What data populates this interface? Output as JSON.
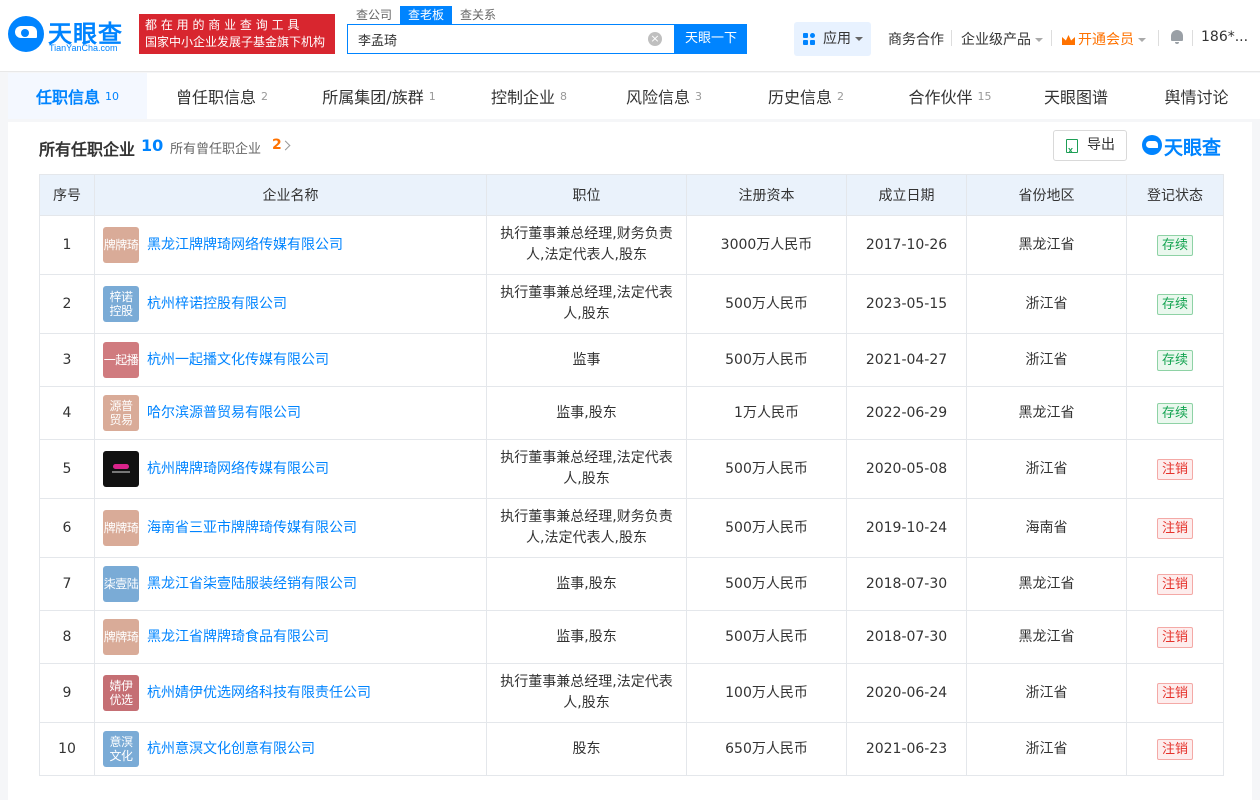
{
  "brand": {
    "name": "天眼查",
    "domain": "TianYanCha.com",
    "slogan_line1": "都 在 用 的 商 业 查 询 工 具",
    "slogan_line2": "国家中小企业发展子基金旗下机构",
    "color": "#0084ff"
  },
  "search": {
    "tabs": [
      "查公司",
      "查老板",
      "查关系"
    ],
    "active_tab": "查老板",
    "value": "李孟琦",
    "button": "天眼一下"
  },
  "nav": {
    "apps": "应用",
    "business": "商务合作",
    "enterprise": "企业级产品",
    "vip": "开通会员",
    "user": "186*..."
  },
  "tabs": [
    {
      "label": "任职信息",
      "count": "10",
      "active": true
    },
    {
      "label": "曾任职信息",
      "count": "2"
    },
    {
      "label": "所属集团/族群",
      "count": "1"
    },
    {
      "label": "控制企业",
      "count": "8"
    },
    {
      "label": "风险信息",
      "count": "3"
    },
    {
      "label": "历史信息",
      "count": "2"
    },
    {
      "label": "合作伙伴",
      "count": "15"
    },
    {
      "label": "天眼图谱",
      "count": ""
    },
    {
      "label": "舆情讨论",
      "count": ""
    }
  ],
  "section": {
    "title": "所有任职企业",
    "count": "10",
    "sub_label": "所有曾任职企业",
    "sub_count": "2",
    "export": "导出",
    "watermark": "天眼查"
  },
  "table": {
    "headers": [
      "序号",
      "企业名称",
      "职位",
      "注册资本",
      "成立日期",
      "省份地区",
      "登记状态"
    ],
    "rows": [
      {
        "no": "1",
        "logo": "牌牌琦",
        "logo_color": "#d9ab98",
        "name": "黑龙江牌牌琦网络传媒有限公司",
        "position": "执行董事兼总经理,财务负责人,法定代表人,股东",
        "capital": "3000万人民币",
        "date": "2017-10-26",
        "region": "黑龙江省",
        "status": "存续",
        "status_type": "ok"
      },
      {
        "no": "2",
        "logo": "梓诺\n控股",
        "logo_color": "#7aabd6",
        "name": "杭州梓诺控股有限公司",
        "position": "执行董事兼总经理,法定代表人,股东",
        "capital": "500万人民币",
        "date": "2023-05-15",
        "region": "浙江省",
        "status": "存续",
        "status_type": "ok"
      },
      {
        "no": "3",
        "logo": "一起播",
        "logo_color": "#d07b7f",
        "name": "杭州一起播文化传媒有限公司",
        "position": "监事",
        "capital": "500万人民币",
        "date": "2021-04-27",
        "region": "浙江省",
        "status": "存续",
        "status_type": "ok"
      },
      {
        "no": "4",
        "logo": "源普\n贸易",
        "logo_color": "#d9ab98",
        "name": "哈尔滨源普贸易有限公司",
        "position": "监事,股东",
        "capital": "1万人民币",
        "date": "2022-06-29",
        "region": "黑龙江省",
        "status": "存续",
        "status_type": "ok"
      },
      {
        "no": "5",
        "logo": "",
        "logo_color": "#111111",
        "name": "杭州牌牌琦网络传媒有限公司",
        "position": "执行董事兼总经理,法定代表人,股东",
        "capital": "500万人民币",
        "date": "2020-05-08",
        "region": "浙江省",
        "status": "注销",
        "status_type": "bad"
      },
      {
        "no": "6",
        "logo": "牌牌琦",
        "logo_color": "#d9ab98",
        "name": "海南省三亚市牌牌琦传媒有限公司",
        "position": "执行董事兼总经理,财务负责人,法定代表人,股东",
        "capital": "500万人民币",
        "date": "2019-10-24",
        "region": "海南省",
        "status": "注销",
        "status_type": "bad"
      },
      {
        "no": "7",
        "logo": "柒壹陆",
        "logo_color": "#7aabd6",
        "name": "黑龙江省柒壹陆服装经销有限公司",
        "position": "监事,股东",
        "capital": "500万人民币",
        "date": "2018-07-30",
        "region": "黑龙江省",
        "status": "注销",
        "status_type": "bad"
      },
      {
        "no": "8",
        "logo": "牌牌琦",
        "logo_color": "#d9ab98",
        "name": "黑龙江省牌牌琦食品有限公司",
        "position": "监事,股东",
        "capital": "500万人民币",
        "date": "2018-07-30",
        "region": "黑龙江省",
        "status": "注销",
        "status_type": "bad"
      },
      {
        "no": "9",
        "logo": "婧伊\n优选",
        "logo_color": "#c56f74",
        "name": "杭州婧伊优选网络科技有限责任公司",
        "position": "执行董事兼总经理,法定代表人,股东",
        "capital": "100万人民币",
        "date": "2020-06-24",
        "region": "浙江省",
        "status": "注销",
        "status_type": "bad"
      },
      {
        "no": "10",
        "logo": "意溟\n文化",
        "logo_color": "#7aabd6",
        "name": "杭州意溟文化创意有限公司",
        "position": "股东",
        "capital": "650万人民币",
        "date": "2021-06-23",
        "region": "浙江省",
        "status": "注销",
        "status_type": "bad"
      }
    ]
  }
}
